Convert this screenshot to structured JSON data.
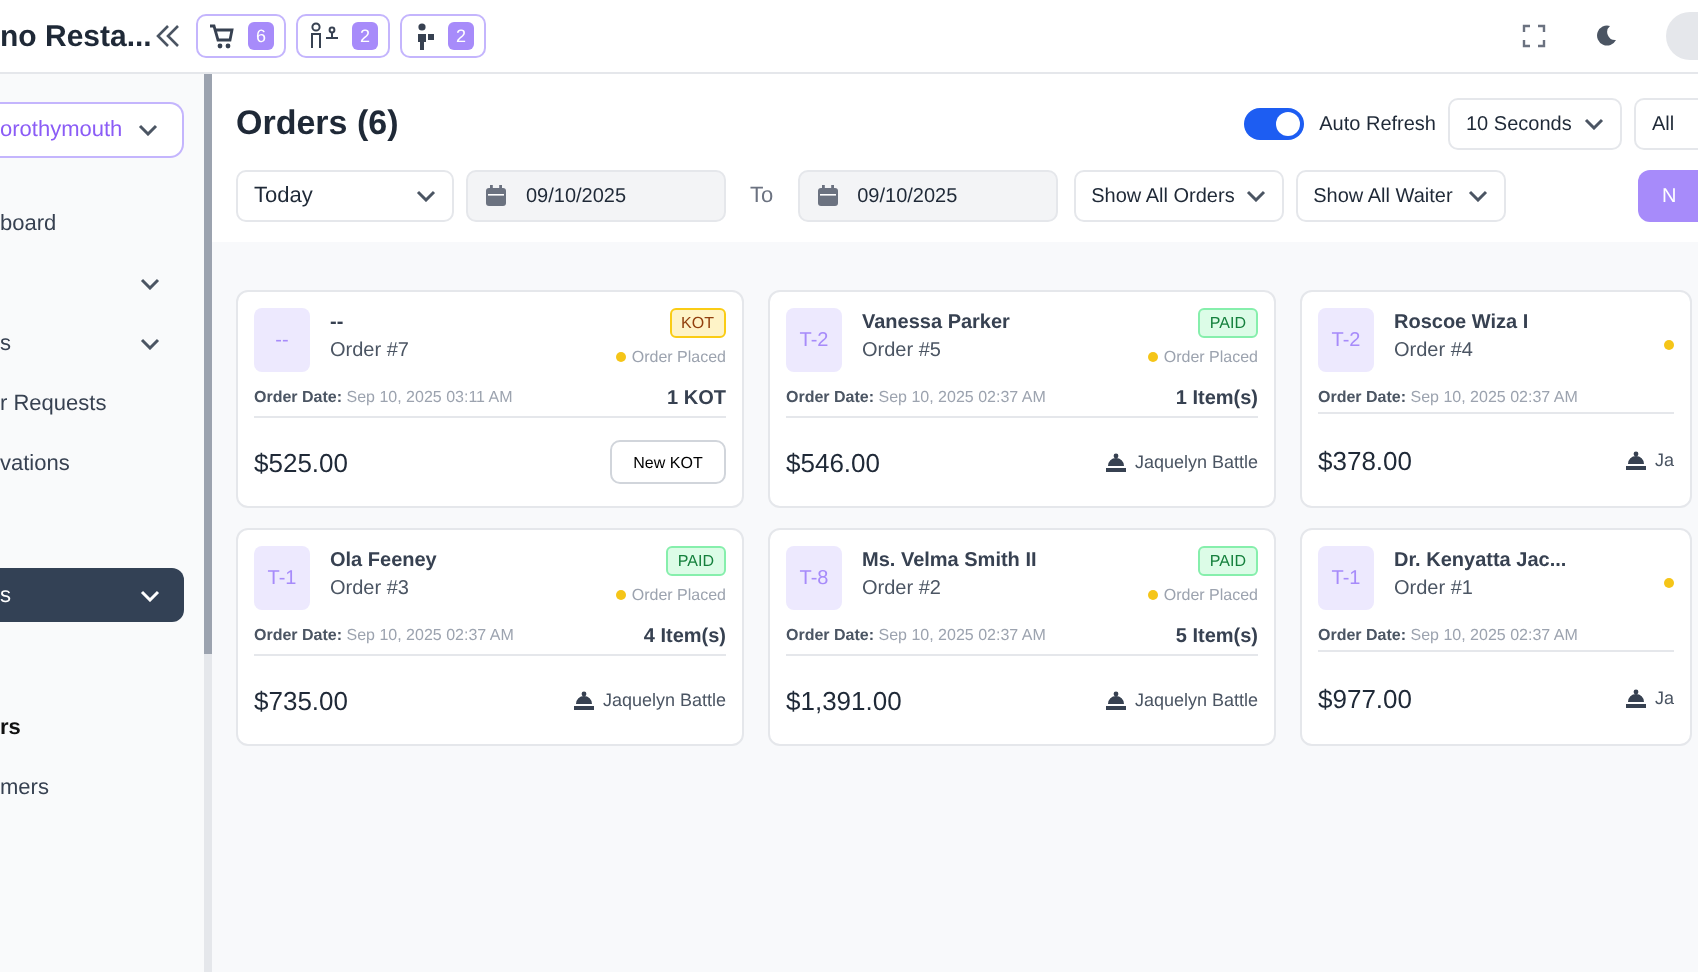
{
  "header": {
    "title": "no Resta...",
    "pills": [
      {
        "kind": "cart",
        "count": "6"
      },
      {
        "kind": "waiter",
        "count": "2"
      },
      {
        "kind": "person",
        "count": "2"
      }
    ]
  },
  "sidebar": {
    "branch": "orothymouth",
    "groups": [
      {
        "items": [
          {
            "label": "board",
            "chevron": false,
            "selected": false,
            "bold": false
          },
          {
            "chevron": true,
            "selected": false,
            "bold": false
          },
          {
            "label": "s",
            "chevron": true,
            "selected": false,
            "bold": false
          },
          {
            "label": "r Requests",
            "chevron": false,
            "selected": false,
            "bold": false
          },
          {
            "label": "vations",
            "chevron": false,
            "selected": false,
            "bold": false
          }
        ]
      },
      {
        "items": [
          {
            "label": "s",
            "chevron": true,
            "selected": true,
            "bold": false
          }
        ]
      },
      {
        "items": [
          {
            "label": "rs",
            "chevron": false,
            "selected": false,
            "bold": true
          },
          {
            "label": "mers",
            "chevron": false,
            "selected": false,
            "bold": false
          }
        ]
      }
    ]
  },
  "toolbar": {
    "title": "Orders (6)",
    "auto_refresh": {
      "label": "Auto Refresh",
      "on": true
    },
    "interval": "10 Seconds",
    "filter": "All",
    "period": "Today",
    "from": "09/10/2025",
    "to_label": "To",
    "to": "09/10/2025",
    "orders_filter": "Show All Orders",
    "waiter_filter": "Show All Waiter",
    "new_button": "N"
  },
  "orders": [
    {
      "table": "--",
      "name": "--",
      "order": "Order #7",
      "badge": {
        "label": "KOT",
        "kind": "kot"
      },
      "status": "Order Placed",
      "date_label": "Order Date:",
      "date": "Sep 10, 2025 03:11 AM",
      "count": "1 KOT",
      "total": "$525.00",
      "footer": {
        "kind": "button",
        "label": "New KOT"
      }
    },
    {
      "table": "T-2",
      "name": "Vanessa Parker",
      "order": "Order #5",
      "badge": {
        "label": "PAID",
        "kind": "paid"
      },
      "status": "Order Placed",
      "date_label": "Order Date:",
      "date": "Sep 10, 2025 02:37 AM",
      "count": "1 Item(s)",
      "total": "$546.00",
      "footer": {
        "kind": "waiter",
        "label": "Jaquelyn Battle"
      }
    },
    {
      "table": "T-2",
      "name": "Roscoe Wiza I",
      "order": "Order #4",
      "date_label": "Order Date:",
      "date": "Sep 10, 2025 02:37 AM",
      "total": "$378.00",
      "footer": {
        "kind": "waiter",
        "label": "Ja"
      }
    },
    {
      "table": "T-1",
      "name": "Ola Feeney",
      "order": "Order #3",
      "badge": {
        "label": "PAID",
        "kind": "paid"
      },
      "status": "Order Placed",
      "date_label": "Order Date:",
      "date": "Sep 10, 2025 02:37 AM",
      "count": "4 Item(s)",
      "total": "$735.00",
      "footer": {
        "kind": "waiter",
        "label": "Jaquelyn Battle"
      }
    },
    {
      "table": "T-8",
      "name": "Ms. Velma Smith II",
      "order": "Order #2",
      "badge": {
        "label": "PAID",
        "kind": "paid"
      },
      "status": "Order Placed",
      "date_label": "Order Date:",
      "date": "Sep 10, 2025 02:37 AM",
      "count": "5 Item(s)",
      "total": "$1,391.00",
      "footer": {
        "kind": "waiter",
        "label": "Jaquelyn Battle"
      }
    },
    {
      "table": "T-1",
      "name": "Dr. Kenyatta Jac...",
      "order": "Order #1",
      "date_label": "Order Date:",
      "date": "Sep 10, 2025 02:37 AM",
      "total": "$977.00",
      "footer": {
        "kind": "waiter",
        "label": "Ja"
      }
    }
  ]
}
